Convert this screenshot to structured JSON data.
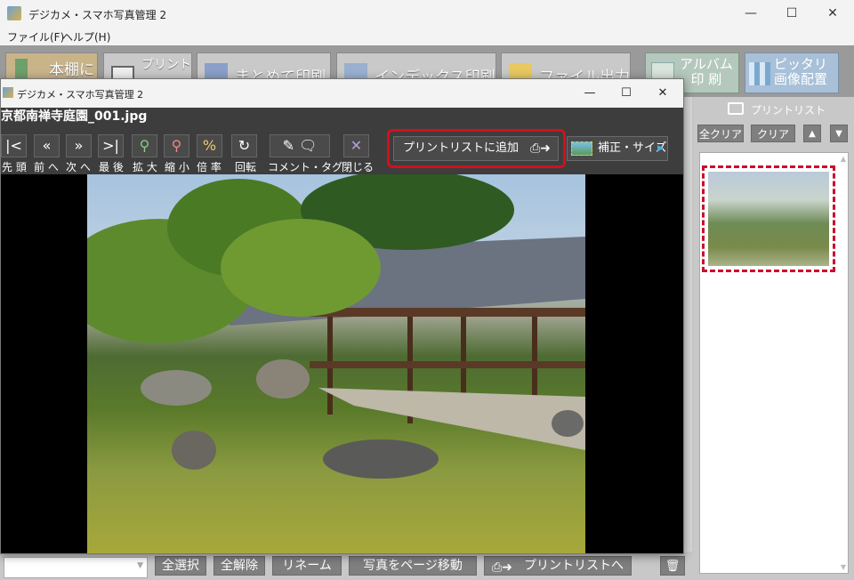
{
  "window": {
    "title": "デジカメ・スマホ写真管理 2"
  },
  "menu": {
    "file": "ファイル(F)",
    "help": "ヘルプ(H)"
  },
  "toolbar": {
    "shelf": "本棚に",
    "print": "プリント",
    "batch_print": "まとめて印刷",
    "index_print": "インデックス印刷",
    "file_output": "ファイル出力",
    "album_line1": "アルバム",
    "album_line2": "印 刷",
    "fit_line1": "ピッタリ",
    "fit_line2": "画像配置"
  },
  "right_panel": {
    "title": "プリントリスト",
    "clear_all": "全クリア",
    "clear": "クリア"
  },
  "bottom": {
    "select_all": "全選択",
    "deselect_all": "全解除",
    "rename": "リネーム",
    "move_page": "写真をページ移動",
    "to_printlist": "プリントリストへ"
  },
  "viewer": {
    "title": "デジカメ・スマホ写真管理 2",
    "filename": "京都南禅寺庭園_001.jpg",
    "nav": {
      "first": "先 頭",
      "prev": "前 へ",
      "next": "次 へ",
      "last": "最 後",
      "zoom_in": "拡 大",
      "zoom_out": "縮 小",
      "ratio": "倍 率",
      "rotate": "回転",
      "comment_tag": "コメント・タグ",
      "close": "閉じる"
    },
    "add_to_printlist": "プリントリストに追加",
    "adjust_size": "補正・サイズ"
  }
}
